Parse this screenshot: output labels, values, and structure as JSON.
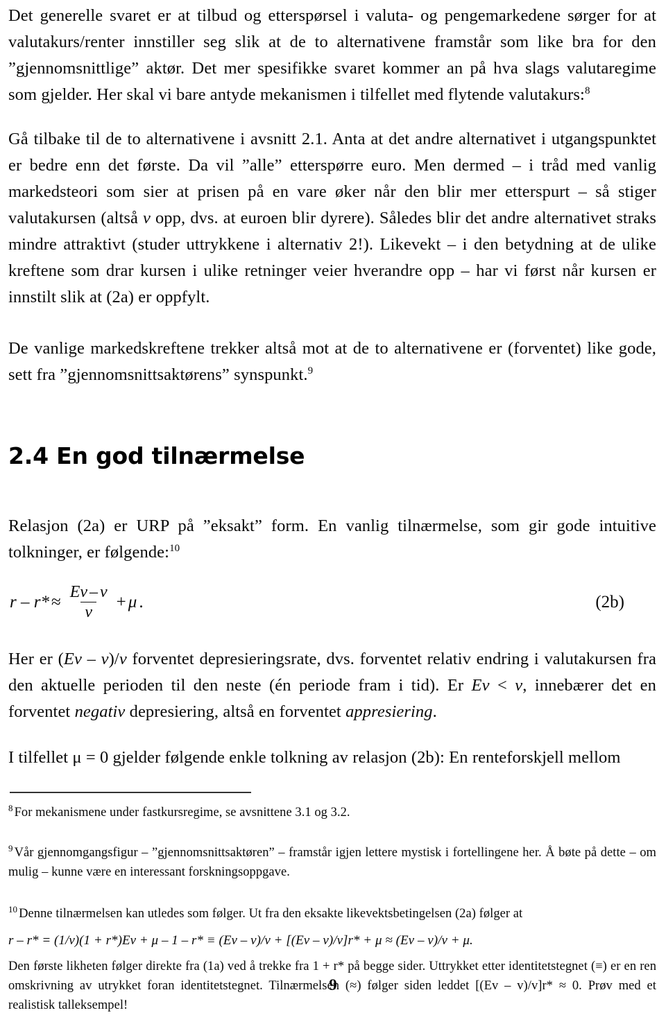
{
  "document": {
    "page_number": "9",
    "language": "no"
  },
  "paragraphs": {
    "p1_part1": "Det generelle svaret er at tilbud og etterspørsel i valuta- og pengemarkedene sørger for at valutakurs/renter innstiller seg slik at de to alternativene framstår som like bra for den ”gjennomsnittlige” aktør. Det mer spesifikke svaret kommer an på hva slags valutaregime som gjelder. Her skal vi bare antyde mekanismen i tilfellet med flytende valutakurs:",
    "p1_footnote_ref": "8",
    "p2_a": "Gå tilbake til de to alternativene i avsnitt 2.1. Anta at det andre alternativet i utgangspunktet er bedre enn det første. Da vil ”alle” etterspørre euro. Men dermed – i tråd med vanlig markedsteori som sier at prisen på en vare øker når den blir mer etterspurt – så stiger valutakursen (altså ",
    "p2_var": "v",
    "p2_b": " opp, dvs. at euroen blir dyrere). Således blir det andre alternativet straks mindre attraktivt (studer uttrykkene i alternativ 2!). Likevekt – i den betydning at de ulike kreftene som drar kursen i ulike retninger veier hverandre opp – har vi først når kursen er innstilt slik at (2a) er oppfylt.",
    "p3": "De vanlige markedskreftene trekker altså mot at de to alternativene er (forventet) like gode, sett fra ”gjennomsnittsaktørens” synspunkt.",
    "p3_footnote_ref": "9",
    "p4": "Relasjon (2a) er URP på ”eksakt” form. En vanlig tilnærmelse, som gir gode intuitive tolkninger, er følgende:",
    "p4_footnote_ref": "10",
    "p5_a": "Her er (",
    "p5_ev": "Ev",
    "p5_b": " – ",
    "p5_v1": "v",
    "p5_c": ")/",
    "p5_v2": "v",
    "p5_d": " forventet depresieringsrate, dvs. forventet relativ endring i valutakursen fra den aktuelle perioden til den neste (én periode fram i tid). Er ",
    "p5_ev2": "Ev",
    "p5_e": " < ",
    "p5_v3": "v",
    "p5_f": ", innebærer det en forventet ",
    "p5_i1": "negativ",
    "p5_g": " depresiering, altså en forventet ",
    "p5_i2": "appresiering",
    "p5_h": ".",
    "p6": "I tilfellet μ = 0 gjelder følgende enkle tolkning av relasjon (2b): En renteforskjell mellom"
  },
  "section": {
    "heading": "2.4 En god tilnærmelse"
  },
  "equation": {
    "lhs": "r – r*",
    "approx_sign": "≈",
    "numerator_ev": "Ev",
    "numerator_minus": "–",
    "numerator_v": "v",
    "denominator": "v",
    "plus": "+",
    "mu": "μ",
    "period": ".",
    "number": "(2b)"
  },
  "footnotes": [
    {
      "marker": "8",
      "text": "For mekanismene under fastkursregime, se avsnittene 3.1 og 3.2."
    },
    {
      "marker": "9",
      "text": "Vår gjennomgangsfigur – ”gjennomsnittsaktøren” – framstår igjen lettere mystisk i fortellingene her. Å bøte på dette – om mulig – kunne være en interessant forskningsoppgave."
    },
    {
      "marker": "10",
      "text": "Denne tilnærmelsen kan utledes som følger. Ut fra den eksakte likevektsbetingelsen (2a) følger at",
      "formula": "r – r* = (1/v)(1 + r*)Ev + μ – 1 – r* ≡ (Ev – v)/v + [(Ev – v)/v]r* + μ ≈ (Ev – v)/v + μ.",
      "text_after": "Den første likheten følger direkte fra (1a) ved å trekke fra 1 + r* på begge sider. Uttrykket etter identitetstegnet (≡) er en ren omskrivning av utrykket foran identitetstegnet. Tilnærmelsen (≈) følger siden leddet [(Ev – v)/v]r* ≈ 0. Prøv med et realistisk talleksempel!"
    }
  ]
}
